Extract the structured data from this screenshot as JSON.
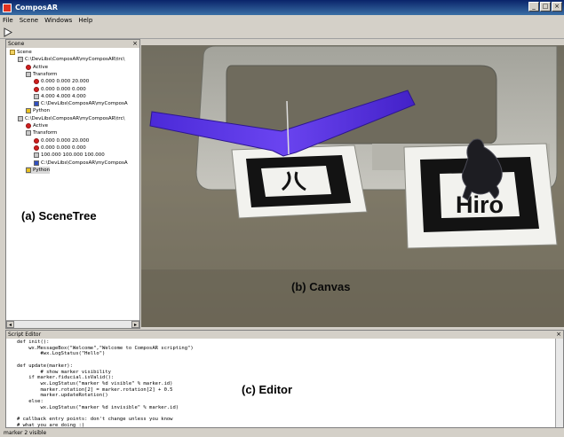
{
  "window": {
    "title": "ComposAR"
  },
  "menu": [
    "File",
    "Scene",
    "Windows",
    "Help"
  ],
  "scene_panel": {
    "title": "Scene",
    "tree": [
      {
        "label": "Scene",
        "level": 0,
        "icon": "folder"
      },
      {
        "label": "C:\\DevLibs\\ComposAR\\myComposAR\\trc\\",
        "level": 1,
        "icon": "grey"
      },
      {
        "label": "Active",
        "level": 2,
        "icon": "red"
      },
      {
        "label": "Transform",
        "level": 2,
        "icon": "grey"
      },
      {
        "label": "0.000 0.000 20.000",
        "level": 3,
        "icon": "red"
      },
      {
        "label": "0.000 0.000 0.000",
        "level": 3,
        "icon": "red"
      },
      {
        "label": "4.000 4.000 4.000",
        "level": 3,
        "icon": "grey"
      },
      {
        "label": "C:\\DevLibs\\ComposAR\\myComposA",
        "level": 3,
        "icon": "blue"
      },
      {
        "label": "Python",
        "level": 2,
        "icon": "yellow"
      },
      {
        "label": "C:\\DevLibs\\ComposAR\\myComposAR\\trc\\",
        "level": 1,
        "icon": "grey"
      },
      {
        "label": "Active",
        "level": 2,
        "icon": "red"
      },
      {
        "label": "Transform",
        "level": 2,
        "icon": "grey"
      },
      {
        "label": "0.000 0.000 20.000",
        "level": 3,
        "icon": "red"
      },
      {
        "label": "0.000 0.000 0.000",
        "level": 3,
        "icon": "red"
      },
      {
        "label": "100.000 100.000 100.000",
        "level": 3,
        "icon": "grey"
      },
      {
        "label": "C:\\DevLibs\\ComposAR\\myComposA",
        "level": 3,
        "icon": "blue"
      },
      {
        "label": "Python",
        "level": 2,
        "icon": "yellow",
        "selected": true
      }
    ]
  },
  "callouts": {
    "scenetree": "(a) SceneTree",
    "canvas": "(b) Canvas",
    "editor": "(c) Editor"
  },
  "canvas": {
    "marker_label": "Hiro",
    "colors": {
      "plane": "#5a2fe0",
      "marker_paper": "#f2f2ee",
      "marker_ink": "#111111"
    }
  },
  "editor": {
    "title": "Script Editor",
    "code": "def init():\n    wx.MessageBox(\"Welcome\",\"Welcome to ComposAR scripting\")\n        #wx.LogStatus(\"Hello\")\n\ndef update(marker):\n        # show marker visibility\n    if marker.fiducial.isValid():\n        wx.LogStatus(\"marker %d visible\" % marker.id)\n        marker.rotation[2] = marker.rotation[2] + 0.5\n        marker.updateRotation()\n    else:\n        wx.LogStatus(\"marker %d invisible\" % marker.id)\n\n# callback entry points: don't change unless you know\n# what you are doing :)"
  },
  "status": "marker 2 visible"
}
